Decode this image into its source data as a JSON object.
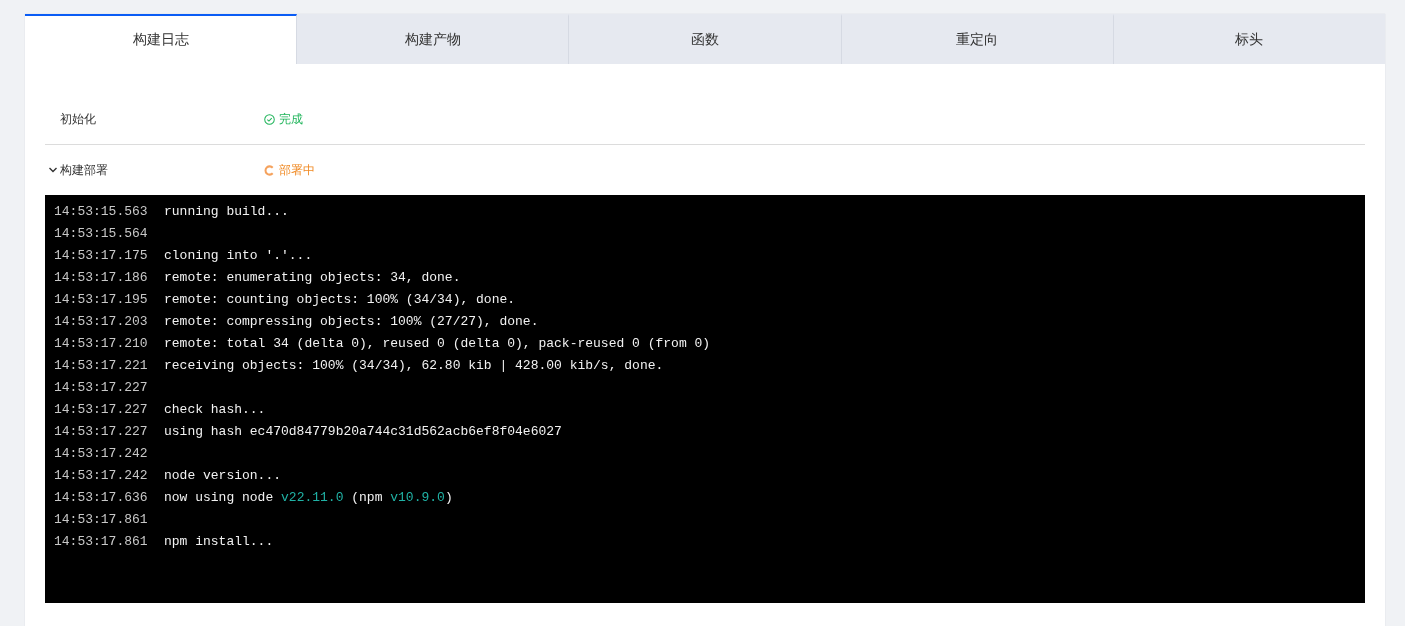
{
  "tabs": [
    {
      "label": "构建日志",
      "selected": true
    },
    {
      "label": "构建产物",
      "selected": false
    },
    {
      "label": "函数",
      "selected": false
    },
    {
      "label": "重定向",
      "selected": false
    },
    {
      "label": "标头",
      "selected": false
    }
  ],
  "stages": [
    {
      "name": "初始化",
      "status": "完成",
      "kind": "done"
    },
    {
      "name": "构建部署",
      "status": "部署中",
      "kind": "running",
      "expanded": true
    }
  ],
  "log": [
    {
      "time": "14:53:15.563",
      "segments": [
        {
          "text": "running build...",
          "kind": "plain"
        }
      ]
    },
    {
      "time": "14:53:15.564"
    },
    {
      "time": "14:53:17.175",
      "segments": [
        {
          "text": "cloning into '.'...",
          "kind": "plain"
        }
      ]
    },
    {
      "time": "14:53:17.186",
      "segments": [
        {
          "text": "remote: enumerating objects: 34, done.",
          "kind": "plain"
        }
      ]
    },
    {
      "time": "14:53:17.195",
      "segments": [
        {
          "text": "remote: counting objects: 100% (34/34), done.",
          "kind": "plain"
        }
      ]
    },
    {
      "time": "14:53:17.203",
      "segments": [
        {
          "text": "remote: compressing objects: 100% (27/27), done.",
          "kind": "plain"
        }
      ]
    },
    {
      "time": "14:53:17.210",
      "segments": [
        {
          "text": "remote: total 34 (delta 0), reused 0 (delta 0), pack-reused 0 (from 0)",
          "kind": "plain"
        }
      ]
    },
    {
      "time": "14:53:17.221",
      "segments": [
        {
          "text": "receiving objects: 100% (34/34), 62.80 kib | 428.00 kib/s, done.",
          "kind": "plain"
        }
      ]
    },
    {
      "time": "14:53:17.227"
    },
    {
      "time": "14:53:17.227",
      "segments": [
        {
          "text": "check hash...",
          "kind": "plain"
        }
      ]
    },
    {
      "time": "14:53:17.227",
      "segments": [
        {
          "text": "using hash ec470d84779b20a744c31d562acb6ef8f04e6027",
          "kind": "plain"
        }
      ]
    },
    {
      "time": "14:53:17.242"
    },
    {
      "time": "14:53:17.242",
      "segments": [
        {
          "text": "node version...",
          "kind": "plain"
        }
      ]
    },
    {
      "time": "14:53:17.636",
      "segments": [
        {
          "text": "now using node ",
          "kind": "plain"
        },
        {
          "text": "v22.11.0",
          "kind": "version"
        },
        {
          "text": " (npm ",
          "kind": "plain"
        },
        {
          "text": "v10.9.0",
          "kind": "version"
        },
        {
          "text": ")",
          "kind": "plain"
        }
      ]
    },
    {
      "time": "14:53:17.861"
    },
    {
      "time": "14:53:17.861",
      "segments": [
        {
          "text": "npm install...",
          "kind": "plain"
        }
      ]
    }
  ]
}
